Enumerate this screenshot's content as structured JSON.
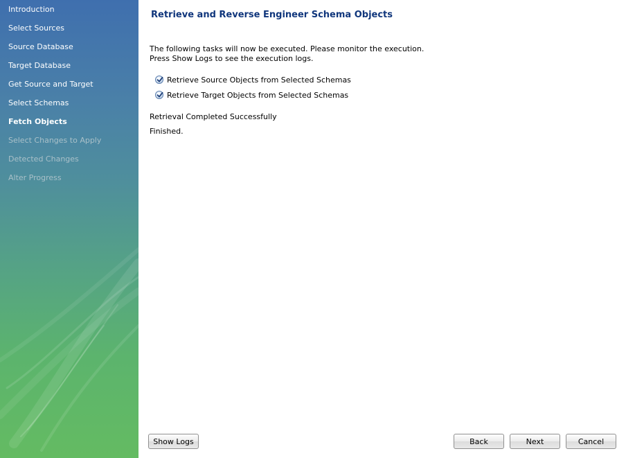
{
  "sidebar": {
    "items": [
      {
        "label": "Introduction",
        "state": "done"
      },
      {
        "label": "Select Sources",
        "state": "done"
      },
      {
        "label": "Source Database",
        "state": "done"
      },
      {
        "label": "Target Database",
        "state": "done"
      },
      {
        "label": "Get Source and Target",
        "state": "done"
      },
      {
        "label": "Select Schemas",
        "state": "done"
      },
      {
        "label": "Fetch Objects",
        "state": "current"
      },
      {
        "label": "Select Changes to Apply",
        "state": "pending"
      },
      {
        "label": "Detected Changes",
        "state": "pending"
      },
      {
        "label": "Alter Progress",
        "state": "pending"
      }
    ]
  },
  "main": {
    "title": "Retrieve and Reverse Engineer Schema Objects",
    "intro_line1": "The following tasks will now be executed. Please monitor the execution.",
    "intro_line2": "Press Show Logs to see the execution logs.",
    "tasks": [
      {
        "label": "Retrieve Source Objects from Selected Schemas",
        "status_icon": "check-icon"
      },
      {
        "label": "Retrieve Target Objects from Selected Schemas",
        "status_icon": "check-icon"
      }
    ],
    "status": "Retrieval Completed Successfully",
    "finished": "Finished."
  },
  "buttons": {
    "show_logs": "Show Logs",
    "back": "Back",
    "next": "Next",
    "cancel": "Cancel"
  },
  "colors": {
    "title": "#10367c",
    "sidebar_top": "#3f6fae",
    "sidebar_bottom": "#64bb62",
    "nav_pending": "#a9c0c9"
  }
}
